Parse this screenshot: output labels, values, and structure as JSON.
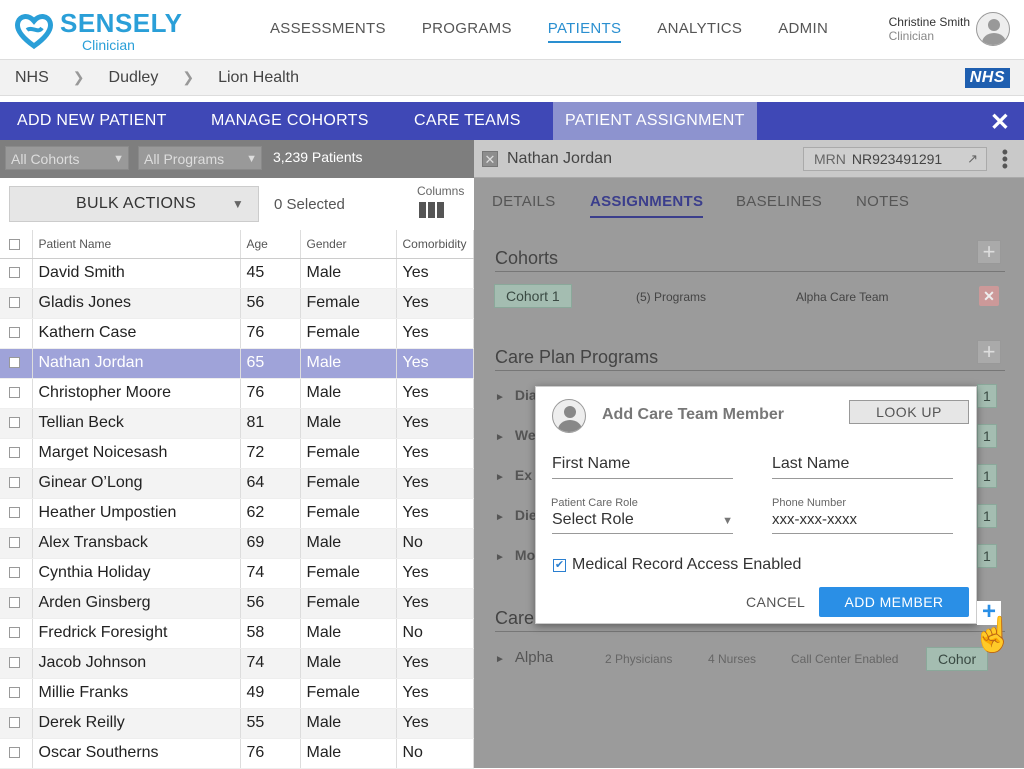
{
  "header": {
    "brand": "SENSELY",
    "sub": "Clinician",
    "nav": [
      "ASSESSMENTS",
      "PROGRAMS",
      "PATIENTS",
      "ANALYTICS",
      "ADMIN"
    ],
    "user_name": "Christine Smith",
    "user_role": "Clinician"
  },
  "breadcrumb": {
    "items": [
      "NHS",
      "Dudley",
      "Lion Health"
    ],
    "badge": "NHS"
  },
  "tabs": [
    "ADD NEW PATIENT",
    "MANAGE COHORTS",
    "CARE TEAMS",
    "PATIENT ASSIGNMENT"
  ],
  "filters": {
    "cohorts": "All Cohorts",
    "programs": "All Programs",
    "count": "3,239 Patients"
  },
  "toolbar": {
    "bulk": "BULK ACTIONS",
    "selected": "0 Selected",
    "columns": "Columns"
  },
  "table": {
    "headers": [
      "Patient Name",
      "Age",
      "Gender",
      "Comorbidity"
    ],
    "rows": [
      [
        "David Smith",
        "45",
        "Male",
        "Yes"
      ],
      [
        "Gladis Jones",
        "56",
        "Female",
        "Yes"
      ],
      [
        "Kathern Case",
        "76",
        "Female",
        "Yes"
      ],
      [
        "Nathan Jordan",
        "65",
        "Male",
        "Yes"
      ],
      [
        "Christopher Moore",
        "76",
        "Male",
        "Yes"
      ],
      [
        "Tellian Beck",
        "81",
        "Male",
        "Yes"
      ],
      [
        "Marget Noicesash",
        "72",
        "Female",
        "Yes"
      ],
      [
        "Ginear O’Long",
        "64",
        "Female",
        "Yes"
      ],
      [
        "Heather Umpostien",
        "62",
        "Female",
        "Yes"
      ],
      [
        "Alex Transback",
        "69",
        "Male",
        "No"
      ],
      [
        "Cynthia Holiday",
        "74",
        "Female",
        "Yes"
      ],
      [
        "Arden Ginsberg",
        "56",
        "Female",
        "Yes"
      ],
      [
        "Fredrick Foresight",
        "58",
        "Male",
        "No"
      ],
      [
        "Jacob Johnson",
        "74",
        "Male",
        "Yes"
      ],
      [
        "Millie Franks",
        "49",
        "Female",
        "Yes"
      ],
      [
        "Derek Reilly",
        "55",
        "Male",
        "Yes"
      ],
      [
        "Oscar Southerns",
        "76",
        "Male",
        "No"
      ]
    ]
  },
  "detail": {
    "name": "Nathan Jordan",
    "mrn_label": "MRN",
    "mrn": "NR923491291",
    "tabs": [
      "DETAILS",
      "ASSIGNMENTS",
      "BASELINES",
      "NOTES"
    ],
    "cohorts_title": "Cohorts",
    "cohort_chip": "Cohort 1",
    "cohort_programs": "(5) Programs",
    "cohort_team": "Alpha Care Team",
    "programs_title": "Care Plan Programs",
    "programs": [
      "Dia",
      "We",
      "Ex",
      "Die",
      "Mo"
    ],
    "program_chip": "1",
    "teams_title": "Care",
    "team": {
      "name": "Alpha",
      "physicians": "2 Physicians",
      "nurses": "4 Nurses",
      "call": "Call Center Enabled",
      "chip": "Cohor"
    }
  },
  "modal": {
    "title": "Add Care Team Member",
    "lookup": "LOOK UP",
    "first_name": "First Name",
    "last_name": "Last Name",
    "role_label": "Patient Care Role",
    "role_value": "Select Role",
    "phone_label": "Phone Number",
    "phone_value": "xxx-xxx-xxxx",
    "access": "Medical Record Access Enabled",
    "cancel": "CANCEL",
    "add": "ADD MEMBER"
  }
}
